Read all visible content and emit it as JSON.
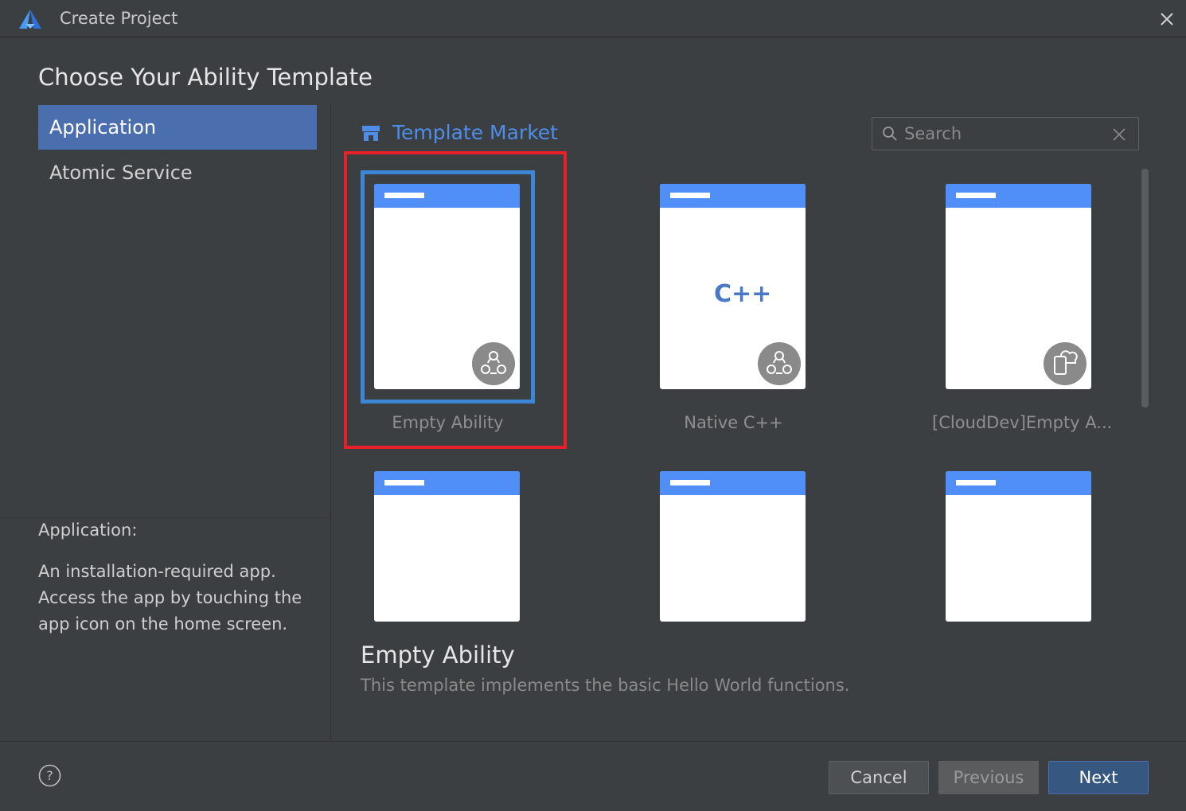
{
  "window": {
    "title": "Create Project",
    "logo_icon": "devEco-logo-icon",
    "close_icon": "close-icon"
  },
  "heading": "Choose Your Ability Template",
  "sidebar": {
    "items": [
      {
        "label": "Application",
        "active": true
      },
      {
        "label": "Atomic Service",
        "active": false
      }
    ],
    "description_title": "Application:",
    "description_body": "An installation-required app. Access the app by touching the app icon on the home screen."
  },
  "template_market": {
    "label": "Template Market",
    "icon": "store-icon"
  },
  "search": {
    "placeholder": "Search",
    "value": ""
  },
  "templates": [
    {
      "name": "Empty Ability",
      "selected": true,
      "badge_icon": "ability-icon"
    },
    {
      "name": "Native C++",
      "selected": false,
      "badge_icon": "ability-icon",
      "center_text": "C++"
    },
    {
      "name": "[CloudDev]Empty A...",
      "selected": false,
      "badge_icon": "cloud-dev-icon"
    },
    {
      "name": "",
      "selected": false
    },
    {
      "name": "",
      "selected": false
    },
    {
      "name": "",
      "selected": false
    }
  ],
  "selected_detail": {
    "title": "Empty Ability",
    "description": "This template implements the basic Hello World functions."
  },
  "footer": {
    "help_icon": "help-icon",
    "cancel_label": "Cancel",
    "previous_label": "Previous",
    "next_label": "Next"
  },
  "colors": {
    "background": "#3c3f41",
    "accent": "#4b6eaf",
    "link": "#4e8ee8",
    "highlight_box": "#e8202a",
    "phone_header": "#4f8ff7"
  }
}
